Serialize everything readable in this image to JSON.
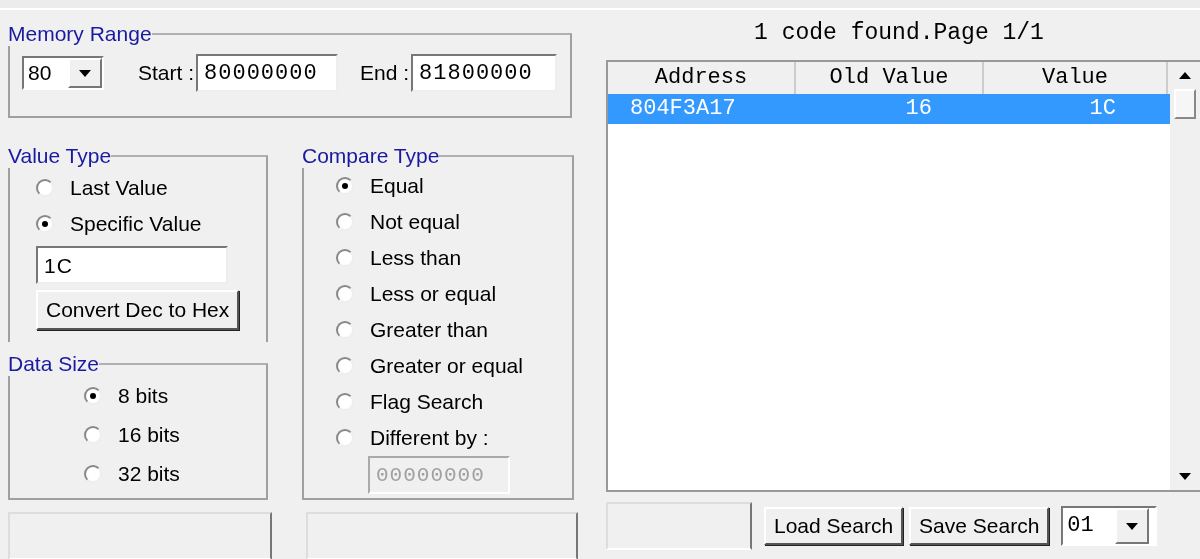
{
  "memory_range": {
    "title": "Memory Range",
    "region": {
      "value": "80"
    },
    "start": {
      "label": "Start :",
      "value": "80000000"
    },
    "end": {
      "label": "End :",
      "value": "81800000"
    }
  },
  "value_type": {
    "title": "Value Type",
    "options": [
      {
        "label": "Last Value",
        "selected": false
      },
      {
        "label": "Specific Value",
        "selected": true
      }
    ],
    "value": "1C",
    "convert_button": "Convert Dec to Hex"
  },
  "data_size": {
    "title": "Data Size",
    "options": [
      {
        "label": "8 bits",
        "selected": true
      },
      {
        "label": "16 bits",
        "selected": false
      },
      {
        "label": "32 bits",
        "selected": false
      }
    ]
  },
  "compare_type": {
    "title": "Compare Type",
    "options": [
      {
        "label": "Equal",
        "selected": true
      },
      {
        "label": "Not equal",
        "selected": false
      },
      {
        "label": "Less than",
        "selected": false
      },
      {
        "label": "Less or equal",
        "selected": false
      },
      {
        "label": "Greater than",
        "selected": false
      },
      {
        "label": "Greater or equal",
        "selected": false
      },
      {
        "label": "Flag Search",
        "selected": false
      },
      {
        "label": "Different by :",
        "selected": false
      }
    ],
    "different_by": {
      "value": "00000000",
      "disabled": true
    }
  },
  "results": {
    "status": "1 code found.Page 1/1",
    "columns": [
      "Address",
      "Old Value",
      "Value"
    ],
    "rows": [
      {
        "cells": [
          "804F3A17",
          "16",
          "1C"
        ],
        "selected": true
      }
    ]
  },
  "buttons": [
    "Load Search",
    "Save Search"
  ],
  "page_select": {
    "value": "01"
  }
}
